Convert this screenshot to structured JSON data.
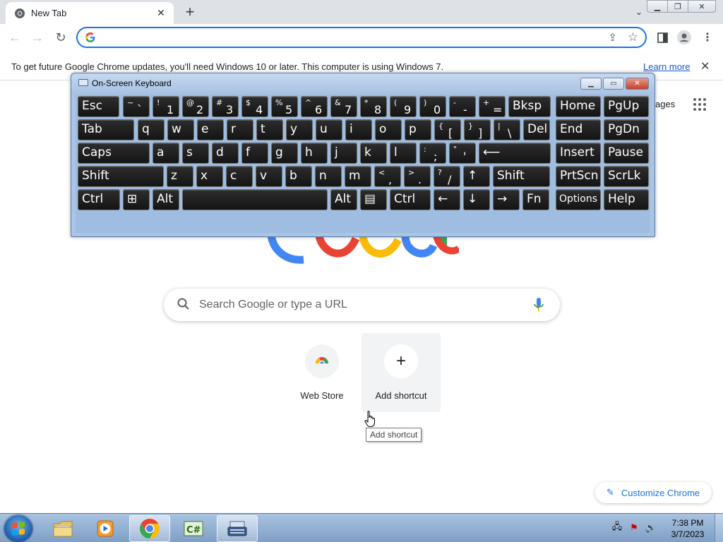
{
  "browser": {
    "tab_title": "New Tab",
    "omnibox_value": "",
    "infobar_message": "To get future Google Chrome updates, you'll need Windows 10 or later. This computer is using Windows 7.",
    "infobar_link": "Learn more"
  },
  "ntp": {
    "images_link_partial": "ages",
    "search_placeholder": "Search Google or type a URL",
    "shortcuts": [
      {
        "label": "Web Store"
      },
      {
        "label": "Add shortcut",
        "glyph": "+"
      }
    ],
    "tooltip": "Add shortcut",
    "customize_label": "Customize Chrome"
  },
  "osk": {
    "title": "On-Screen Keyboard",
    "rows": [
      [
        {
          "label": "Esc"
        },
        {
          "top": "~",
          "bottom": "`"
        },
        {
          "top": "!",
          "bottom": "1"
        },
        {
          "top": "@",
          "bottom": "2"
        },
        {
          "top": "#",
          "bottom": "3"
        },
        {
          "top": "$",
          "bottom": "4"
        },
        {
          "top": "%",
          "bottom": "5"
        },
        {
          "top": "^",
          "bottom": "6"
        },
        {
          "top": "&",
          "bottom": "7"
        },
        {
          "top": "*",
          "bottom": "8"
        },
        {
          "top": "(",
          "bottom": "9"
        },
        {
          "top": ")",
          "bottom": "0"
        },
        {
          "top": "-",
          "bottom": "-"
        },
        {
          "top": "+",
          "bottom": "="
        },
        {
          "label": "Bksp"
        },
        {
          "label": "Home"
        },
        {
          "label": "PgUp"
        }
      ],
      [
        {
          "label": "Tab"
        },
        {
          "label": "q"
        },
        {
          "label": "w"
        },
        {
          "label": "e"
        },
        {
          "label": "r"
        },
        {
          "label": "t"
        },
        {
          "label": "y"
        },
        {
          "label": "u"
        },
        {
          "label": "i"
        },
        {
          "label": "o"
        },
        {
          "label": "p"
        },
        {
          "top": "{",
          "bottom": "["
        },
        {
          "top": "}",
          "bottom": "]"
        },
        {
          "top": "|",
          "bottom": "\\"
        },
        {
          "label": "Del"
        },
        {
          "label": "End"
        },
        {
          "label": "PgDn"
        }
      ],
      [
        {
          "label": "Caps"
        },
        {
          "label": "a"
        },
        {
          "label": "s"
        },
        {
          "label": "d"
        },
        {
          "label": "f"
        },
        {
          "label": "g"
        },
        {
          "label": "h"
        },
        {
          "label": "j"
        },
        {
          "label": "k"
        },
        {
          "label": "l"
        },
        {
          "top": ":",
          "bottom": ";"
        },
        {
          "top": "\"",
          "bottom": "'"
        },
        {
          "label": "⟵"
        },
        {
          "label": "Insert"
        },
        {
          "label": "Pause"
        }
      ],
      [
        {
          "label": "Shift"
        },
        {
          "label": "z"
        },
        {
          "label": "x"
        },
        {
          "label": "c"
        },
        {
          "label": "v"
        },
        {
          "label": "b"
        },
        {
          "label": "n"
        },
        {
          "label": "m"
        },
        {
          "top": "<",
          "bottom": ","
        },
        {
          "top": ">",
          "bottom": "."
        },
        {
          "top": "?",
          "bottom": "/"
        },
        {
          "label": "↑"
        },
        {
          "label": "Shift"
        },
        {
          "label": "PrtScn"
        },
        {
          "label": "ScrLk"
        }
      ],
      [
        {
          "label": "Ctrl"
        },
        {
          "label": "⊞"
        },
        {
          "label": "Alt"
        },
        {
          "label": ""
        },
        {
          "label": "Alt"
        },
        {
          "label": "▤"
        },
        {
          "label": "Ctrl"
        },
        {
          "label": "←"
        },
        {
          "label": "↓"
        },
        {
          "label": "→"
        },
        {
          "label": "Fn"
        },
        {
          "label": "Options"
        },
        {
          "label": "Help"
        }
      ]
    ]
  },
  "taskbar": {
    "time": "7:38 PM",
    "date": "3/7/2023",
    "apps": [
      {
        "name": "file-explorer"
      },
      {
        "name": "media-player"
      },
      {
        "name": "chrome"
      },
      {
        "name": "csharp-editor"
      },
      {
        "name": "on-screen-keyboard"
      }
    ]
  }
}
